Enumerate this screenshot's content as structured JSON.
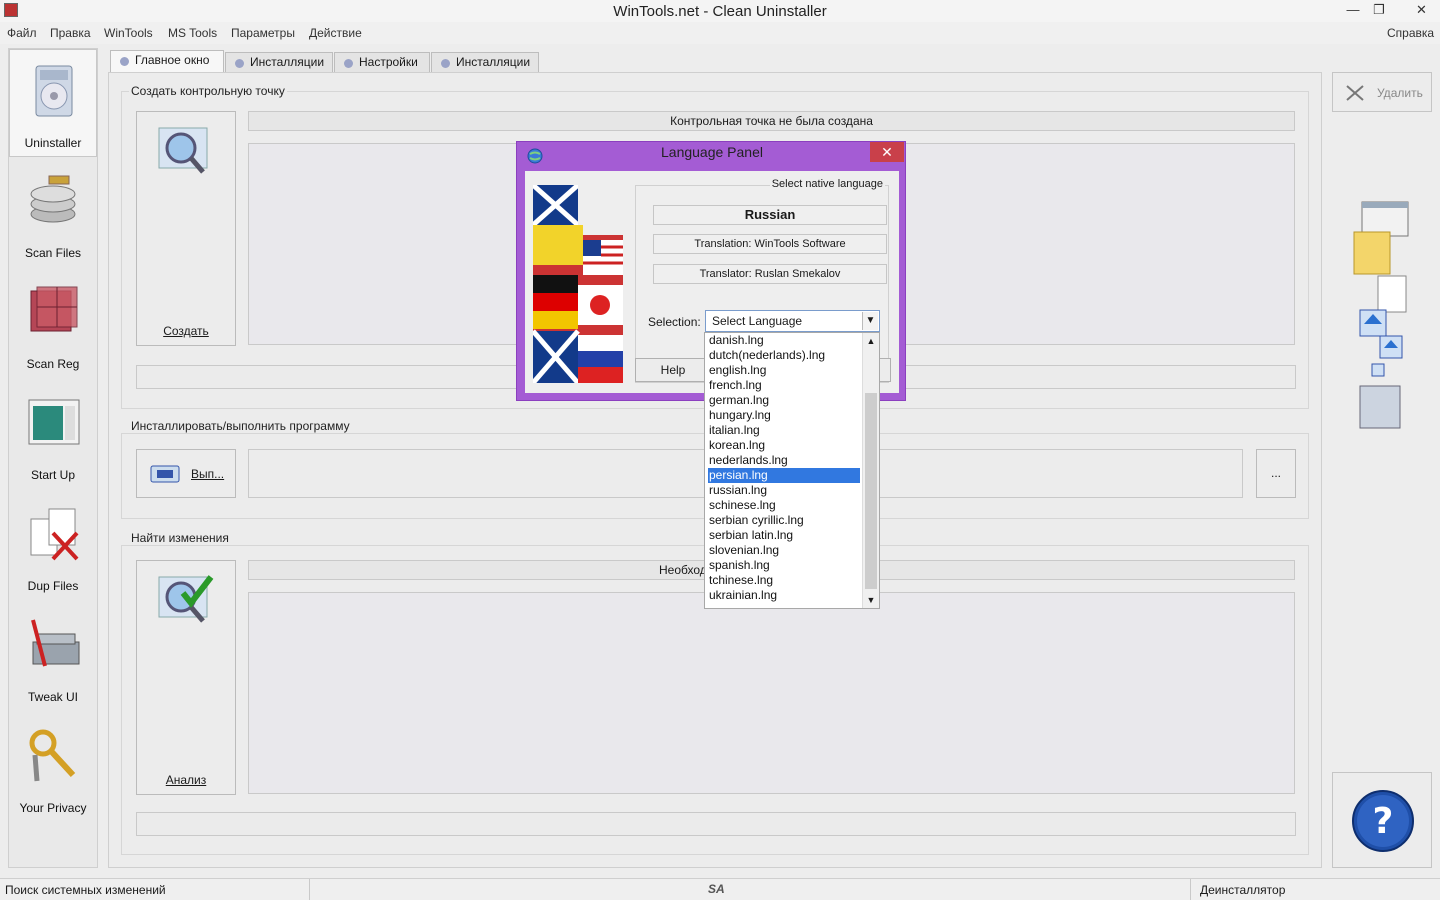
{
  "window": {
    "title": "WinTools.net - Clean Uninstaller"
  },
  "menu": {
    "items": [
      "Файл",
      "Правка",
      "WinTools",
      "MS Tools",
      "Параметры",
      "Действие"
    ],
    "help": "Справка"
  },
  "sidebar": {
    "items": [
      {
        "label": "Uninstaller",
        "icon": "uninstaller-icon"
      },
      {
        "label": "Scan Files",
        "icon": "scan-files-icon"
      },
      {
        "label": "Scan Reg",
        "icon": "scan-reg-icon"
      },
      {
        "label": "Start Up",
        "icon": "start-up-icon"
      },
      {
        "label": "Dup Files",
        "icon": "dup-files-icon"
      },
      {
        "label": "Tweak UI",
        "icon": "tweak-ui-icon"
      },
      {
        "label": "Your Privacy",
        "icon": "privacy-icon"
      }
    ]
  },
  "tabs": [
    "Главное окно",
    "Инсталляции",
    "Настройки",
    "Инсталляции"
  ],
  "groups": {
    "checkpoint": {
      "title": "Создать контрольную точку",
      "button": "Создать",
      "status": "Контрольная точка не была создана"
    },
    "install": {
      "title": "Инсталлировать/выполнить программу",
      "button": "Вып...",
      "browse": "..."
    },
    "changes": {
      "title": "Найти изменения",
      "button": "Анализ",
      "status": "Необход"
    }
  },
  "right": {
    "delete": "Удалить"
  },
  "statusbar": {
    "left": "Поиск системных изменений",
    "right": "Деинсталлятор",
    "center_logo": "SA"
  },
  "dialog": {
    "title": "Language Panel",
    "heading": "Select native language",
    "language": "Russian",
    "translation": "Translation: WinTools Software",
    "translator": "Translator: Ruslan Smekalov",
    "selection_label": "Selection:",
    "select_value": "Select Language",
    "help_button": "Help",
    "options": [
      "danish.lng",
      "dutch(nederlands).lng",
      "english.lng",
      "french.lng",
      "german.lng",
      "hungary.lng",
      "italian.lng",
      "korean.lng",
      "nederlands.lng",
      "persian.lng",
      "russian.lng",
      "schinese.lng",
      "serbian cyrillic.lng",
      "serbian latin.lng",
      "slovenian.lng",
      "spanish.lng",
      "tchinese.lng",
      "ukrainian.lng"
    ],
    "highlighted": "persian.lng"
  },
  "colors": {
    "dialog_frame": "#a45cd4",
    "close_button": "#c9404a",
    "selection": "#3178e0"
  }
}
